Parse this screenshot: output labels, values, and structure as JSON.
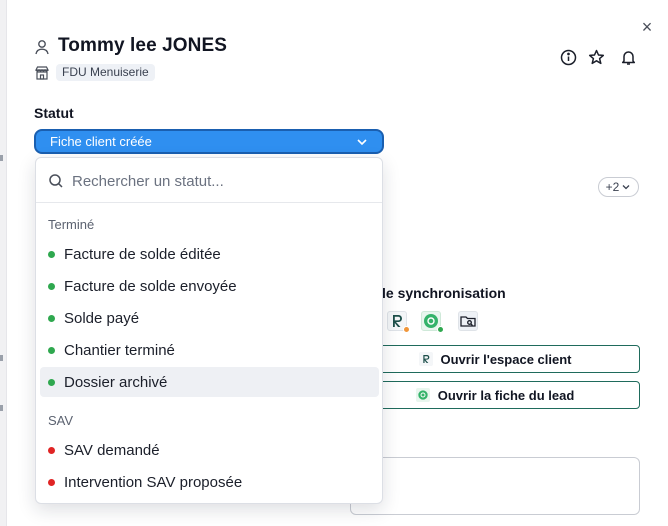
{
  "header": {
    "title": "Tommy lee JONES",
    "company": "FDU Menuiserie",
    "close_glyph": "×"
  },
  "status": {
    "label": "Statut",
    "selected": "Fiche client créée",
    "search_placeholder": "Rechercher un statut...",
    "groups": [
      {
        "label": "Terminé",
        "color": "#2fa84f",
        "options": [
          "Facture de solde éditée",
          "Facture de solde envoyée",
          "Solde payé",
          "Chantier terminé",
          "Dossier archivé"
        ]
      },
      {
        "label": "SAV",
        "color": "#e02424",
        "options": [
          "SAV demandé",
          "Intervention SAV proposée"
        ]
      }
    ],
    "highlighted_option": "Dossier archivé"
  },
  "tags": {
    "extra_count": "+2"
  },
  "sync": {
    "title": "le synchronisation",
    "open_client_space": "Ouvrir l'espace client",
    "open_lead": "Ouvrir la fiche du lead"
  },
  "colors": {
    "accent": "#2f8ff0",
    "accent_border": "#1a5fb0",
    "sync_border": "#1f6b5c",
    "green_status": "#2fa84f",
    "red_status": "#e02424",
    "orange_dot": "#f0963a"
  },
  "icons": {
    "person": "person-icon",
    "store": "store-icon",
    "info": "info-icon",
    "star": "star-icon",
    "bell": "bell-icon",
    "close": "close-icon",
    "chevron": "chevron-down-icon",
    "search": "search-icon"
  }
}
